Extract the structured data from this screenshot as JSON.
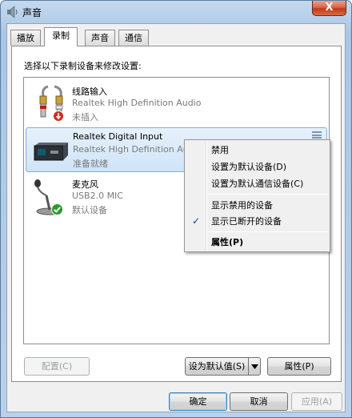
{
  "window": {
    "title": "声音",
    "close_label": "X"
  },
  "tabs": [
    {
      "label": "播放"
    },
    {
      "label": "录制"
    },
    {
      "label": "声音"
    },
    {
      "label": "通信"
    }
  ],
  "instruction": "选择以下录制设备来修改设置:",
  "devices": [
    {
      "name": "线路输入",
      "driver": "Realtek High Definition Audio",
      "status": "未插入",
      "icon": "line-in-jack-icon",
      "badge": "unplugged-badge-icon"
    },
    {
      "name": "Realtek Digital Input",
      "driver": "Realtek High Definition Audio",
      "status": "准备就绪",
      "icon": "digital-input-device-icon",
      "selected": true
    },
    {
      "name": "麦克风",
      "driver": "USB2.0 MIC",
      "status": "默认设备",
      "icon": "microphone-icon",
      "badge": "default-check-icon"
    }
  ],
  "context_menu": {
    "items": [
      {
        "label": "禁用"
      },
      {
        "label": "设置为默认设备(D)"
      },
      {
        "label": "设置为默认通信设备(C)"
      },
      {
        "label": "显示禁用的设备"
      },
      {
        "label": "显示已断开的设备",
        "checked": true
      },
      {
        "label": "属性(P)",
        "bold": true
      }
    ],
    "check_mark": "✓"
  },
  "panel_buttons": {
    "configure": "配置(C)",
    "set_default": "设为默认值(S)",
    "properties": "属性(P)"
  },
  "dialog_buttons": {
    "ok": "确定",
    "cancel": "取消",
    "apply": "应用(A)"
  },
  "colors": {
    "selection": "#cfe4f8",
    "titlebar": "#b9d1ea",
    "close": "#c3391c"
  }
}
